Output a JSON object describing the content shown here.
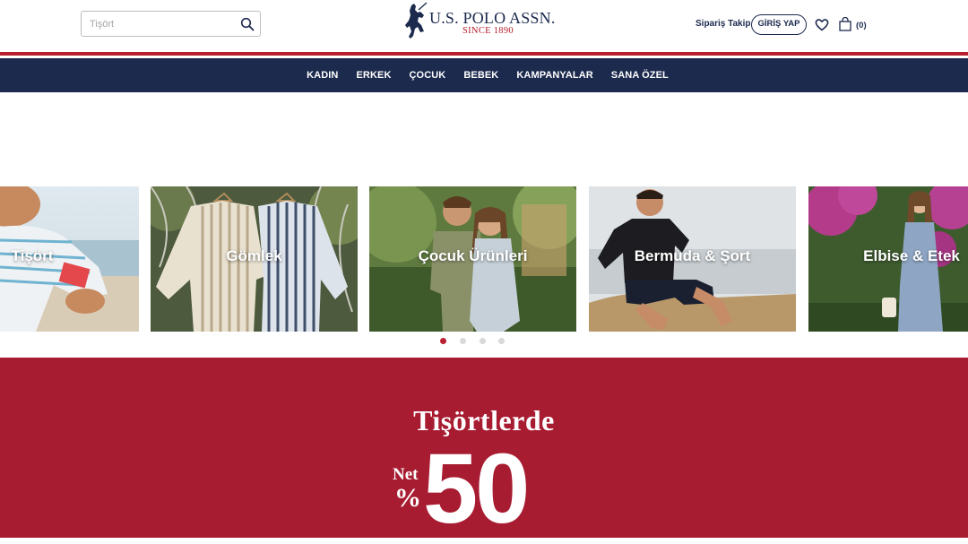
{
  "search": {
    "placeholder": "Tişört",
    "icon": "search-icon"
  },
  "logo": {
    "brand": "U.S. POLO ASSN.",
    "since": "SINCE 1890"
  },
  "header": {
    "track_order": "Sipariş Takip",
    "login": "GİRİŞ YAP",
    "favorites_icon": "heart-icon",
    "cart_icon": "shopping-bag-icon",
    "cart_count": "(0)"
  },
  "nav": {
    "items": [
      "KADIN",
      "ERKEK",
      "ÇOCUK",
      "BEBEK",
      "KAMPANYALAR",
      "SANA ÖZEL"
    ]
  },
  "carousel": {
    "cards": [
      {
        "label": "Tişört"
      },
      {
        "label": "Gömlek"
      },
      {
        "label": "Çocuk Ürünleri"
      },
      {
        "label": "Bermuda & Şort"
      },
      {
        "label": "Elbise & Etek"
      }
    ],
    "dots": 4,
    "active_dot": 0
  },
  "promo": {
    "title": "Tişörtlerde",
    "net": "Net",
    "percent": "%",
    "discount": "50"
  },
  "colors": {
    "navy": "#1c2a4e",
    "red": "#b8202f",
    "promo_bg": "#a81c32"
  }
}
